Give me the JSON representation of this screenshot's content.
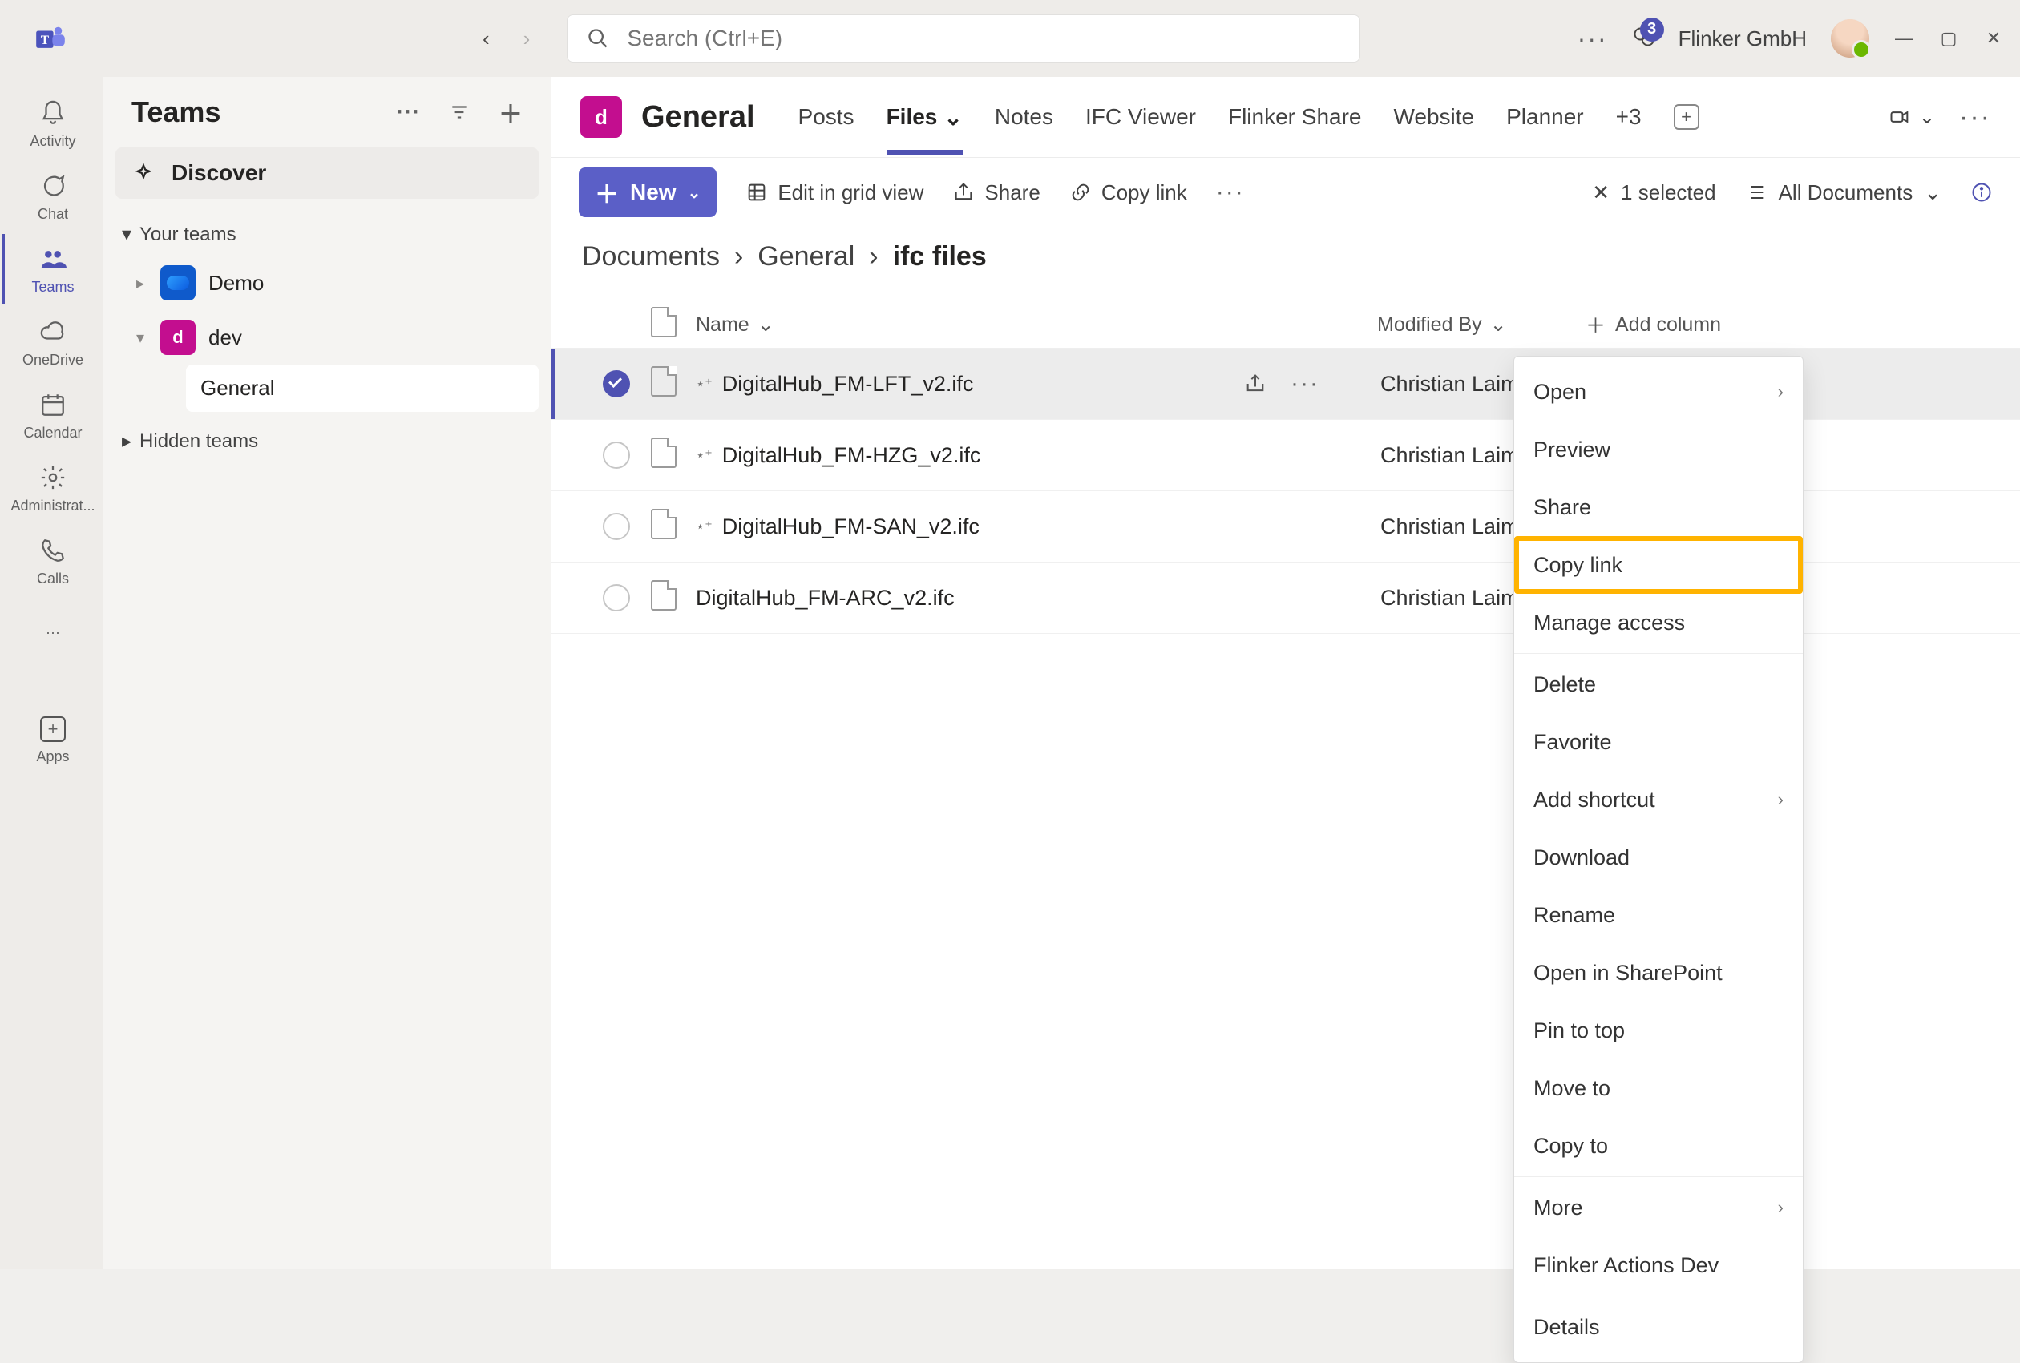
{
  "titlebar": {
    "search_placeholder": "Search (Ctrl+E)",
    "notif_count": 3,
    "org_name": "Flinker GmbH"
  },
  "apprail": {
    "items": [
      {
        "id": "activity",
        "label": "Activity"
      },
      {
        "id": "chat",
        "label": "Chat"
      },
      {
        "id": "teams",
        "label": "Teams",
        "active": true
      },
      {
        "id": "onedrive",
        "label": "OneDrive"
      },
      {
        "id": "calendar",
        "label": "Calendar"
      },
      {
        "id": "admin",
        "label": "Administrat..."
      },
      {
        "id": "calls",
        "label": "Calls"
      }
    ],
    "apps_label": "Apps"
  },
  "teams_panel": {
    "title": "Teams",
    "discover": "Discover",
    "your_teams": "Your teams",
    "teams": [
      {
        "id": "demo",
        "name": "Demo"
      },
      {
        "id": "dev",
        "name": "dev",
        "channels": [
          {
            "name": "General",
            "selected": true
          }
        ]
      }
    ],
    "hidden_teams": "Hidden teams"
  },
  "main": {
    "team_letter": "d",
    "channel_name": "General",
    "tabs": [
      "Posts",
      "Files",
      "Notes",
      "IFC Viewer",
      "Flinker Share",
      "Website",
      "Planner"
    ],
    "tabs_overflow": "+3",
    "toolbar": {
      "new": "New",
      "edit_grid": "Edit in grid view",
      "share": "Share",
      "copy_link": "Copy link",
      "selected_count": "1 selected",
      "view_name": "All Documents"
    },
    "breadcrumb": [
      "Documents",
      "General",
      "ifc files"
    ],
    "columns": {
      "name": "Name",
      "modified_by": "Modified By",
      "add_column": "Add column"
    },
    "files": [
      {
        "name": "DigitalHub_FM-LFT_v2.ifc",
        "modified_by": "Christian Laimer",
        "selected": true,
        "new": true
      },
      {
        "name": "DigitalHub_FM-HZG_v2.ifc",
        "modified_by": "Christian Laimer",
        "selected": false,
        "new": true
      },
      {
        "name": "DigitalHub_FM-SAN_v2.ifc",
        "modified_by": "Christian Laimer",
        "selected": false,
        "new": true
      },
      {
        "name": "DigitalHub_FM-ARC_v2.ifc",
        "modified_by": "Christian Laimer",
        "selected": false,
        "new": false
      }
    ],
    "context_menu": [
      {
        "label": "Open",
        "submenu": true
      },
      {
        "label": "Preview"
      },
      {
        "label": "Share"
      },
      {
        "label": "Copy link",
        "highlight": true
      },
      {
        "label": "Manage access"
      },
      {
        "sep": true
      },
      {
        "label": "Delete"
      },
      {
        "label": "Favorite"
      },
      {
        "label": "Add shortcut",
        "submenu": true
      },
      {
        "label": "Download"
      },
      {
        "label": "Rename"
      },
      {
        "label": "Open in SharePoint"
      },
      {
        "label": "Pin to top"
      },
      {
        "label": "Move to"
      },
      {
        "label": "Copy to"
      },
      {
        "sep": true
      },
      {
        "label": "More",
        "submenu": true
      },
      {
        "label": "Flinker Actions Dev"
      },
      {
        "sep": true
      },
      {
        "label": "Details"
      }
    ]
  }
}
